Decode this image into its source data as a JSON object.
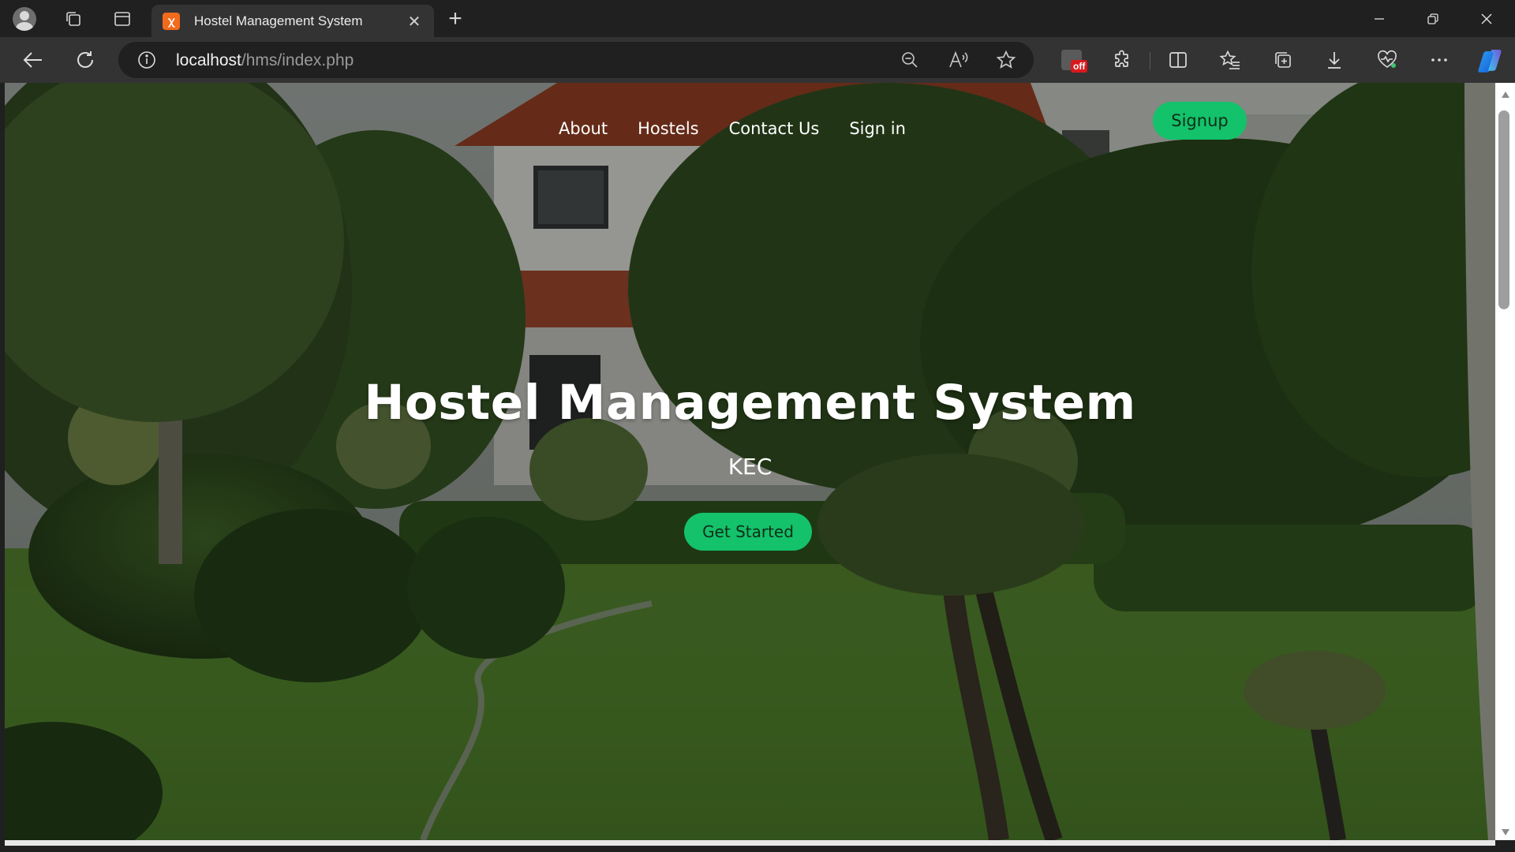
{
  "browser": {
    "tab": {
      "title": "Hostel Management System",
      "favicon": "xampp-icon"
    },
    "address": {
      "host": "localhost",
      "path": "/hms/index.php"
    },
    "extension_badge": "off"
  },
  "site": {
    "nav": [
      {
        "label": "About"
      },
      {
        "label": "Hostels"
      },
      {
        "label": "Contact Us"
      },
      {
        "label": "Sign in"
      }
    ],
    "signup_label": "Signup",
    "hero": {
      "title": "Hostel Management System",
      "subtitle": "KEC",
      "cta_label": "Get Started"
    }
  },
  "colors": {
    "accent_green": "#13c26a",
    "chrome_dark": "#202020",
    "chrome_toolbar": "#333333"
  }
}
